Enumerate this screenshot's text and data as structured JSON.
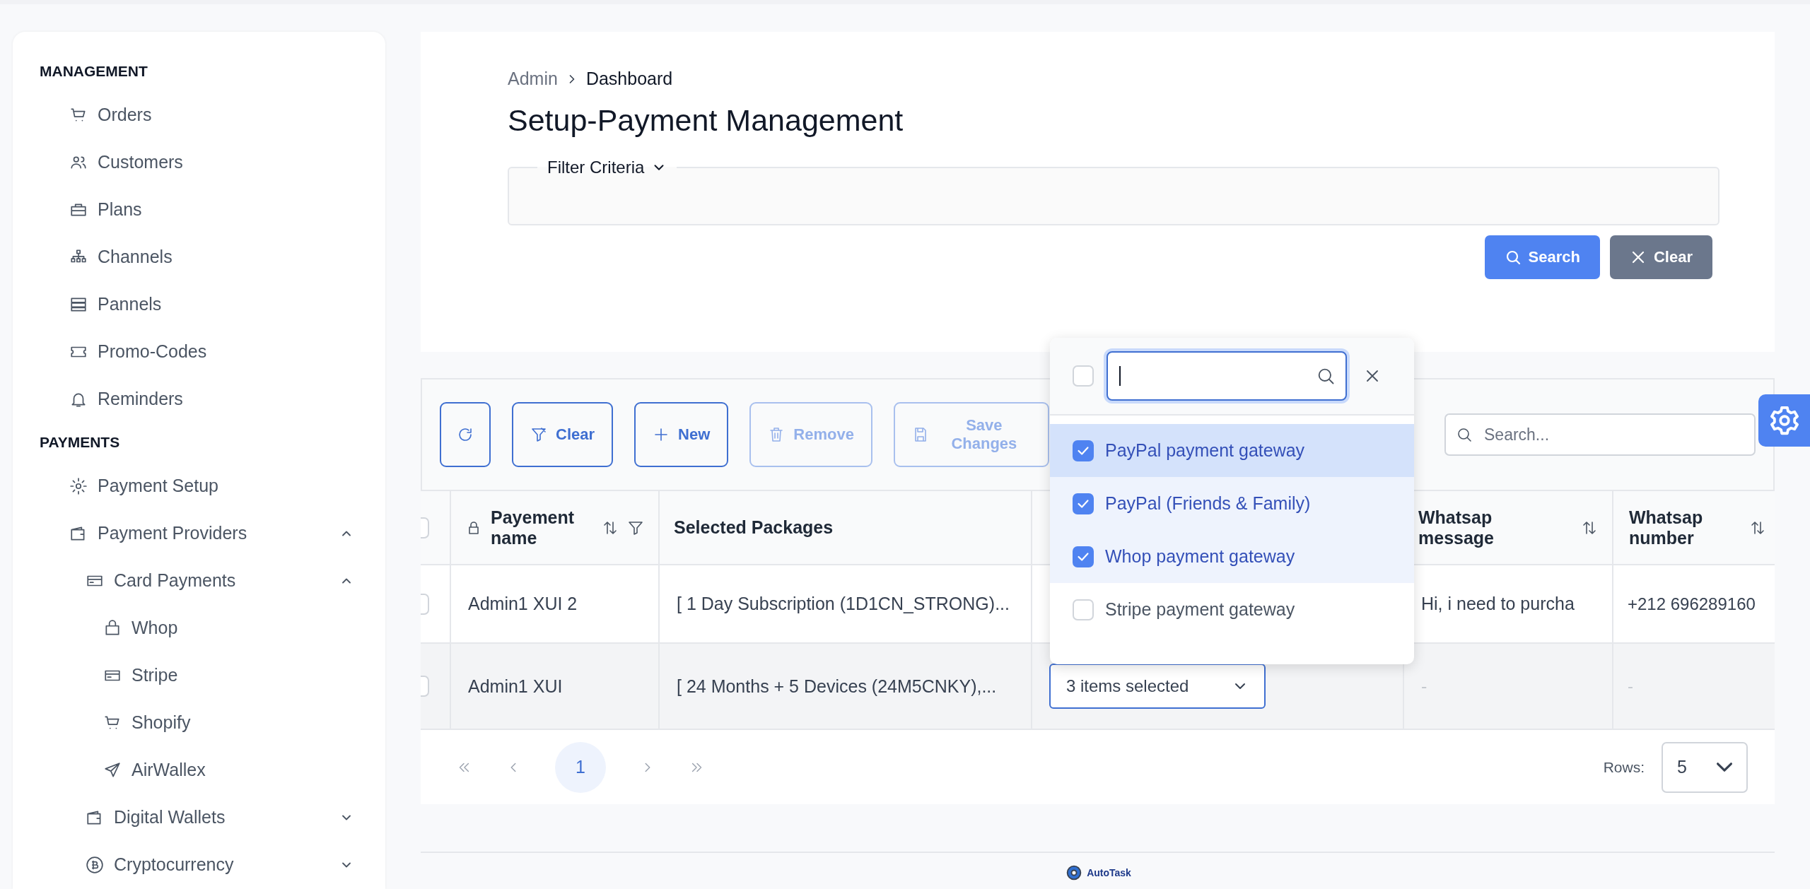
{
  "sidebar": {
    "sections": [
      {
        "title": "MANAGEMENT",
        "items": [
          {
            "label": "Orders"
          },
          {
            "label": "Customers"
          },
          {
            "label": "Plans"
          },
          {
            "label": "Channels"
          },
          {
            "label": "Pannels"
          },
          {
            "label": "Promo-Codes"
          },
          {
            "label": "Reminders"
          }
        ]
      },
      {
        "title": "PAYMENTS",
        "items": [
          {
            "label": "Payment Setup"
          },
          {
            "label": "Payment Providers",
            "expanded": true,
            "children": [
              {
                "label": "Card Payments",
                "expanded": true,
                "children": [
                  {
                    "label": "Whop"
                  },
                  {
                    "label": "Stripe"
                  },
                  {
                    "label": "Shopify"
                  },
                  {
                    "label": "AirWallex"
                  }
                ]
              },
              {
                "label": "Digital Wallets",
                "expanded": false
              },
              {
                "label": "Cryptocurrency",
                "expanded": false
              }
            ]
          }
        ]
      }
    ]
  },
  "breadcrumb": [
    "Admin",
    "Dashboard"
  ],
  "title": "Setup-Payment Management",
  "filter": {
    "legend": "Filter Criteria",
    "expanded": false
  },
  "filter_buttons": [
    {
      "kind": "search",
      "label": "Search"
    },
    {
      "kind": "clear",
      "label": "Clear"
    }
  ],
  "toolbar": {
    "buttons": [
      {
        "kind": "refresh",
        "disabled": false
      },
      {
        "kind": "clear",
        "label": "Clear",
        "disabled": false
      },
      {
        "kind": "new",
        "label": "New",
        "disabled": false
      },
      {
        "kind": "remove",
        "label": "Remove",
        "disabled": true
      },
      {
        "kind": "save",
        "label": "Save Changes",
        "disabled": true
      }
    ],
    "search": {
      "placeholder": "Search..."
    }
  },
  "table": {
    "select_all_checked": false,
    "headers": {
      "payment_name": "Payement name",
      "packages": "Selected Packages",
      "whatsapp_message": "Whatsap message",
      "whatsapp_number": "Whatsap number"
    },
    "rows": [
      {
        "checked": false,
        "active": false,
        "payment_name": "Admin1 XUI 2",
        "packages": "[ 1 Day Subscription (1D1CN_STRONG)...",
        "whatsapp_message": "Hi, i need to purcha",
        "whatsapp_number": "+212 696289160"
      },
      {
        "checked": false,
        "active": true,
        "payment_name": "Admin1 XUI",
        "packages": "[ 24 Months + 5 Devices (24M5CNKY),...",
        "gateways": "3 items selected",
        "whatsapp_message": "-",
        "whatsapp_number": "-"
      }
    ]
  },
  "dropdown": {
    "select_all_checked": false,
    "options": [
      {
        "label": "PayPal payment gateway",
        "checked": true,
        "focused": true
      },
      {
        "label": "PayPal (Friends & Family)",
        "checked": true,
        "focused": false
      },
      {
        "label": "Whop payment gateway",
        "checked": true,
        "focused": false
      },
      {
        "label": "Stripe payment gateway",
        "checked": false,
        "focused": false
      }
    ]
  },
  "pagination": {
    "pages": [
      {
        "label": "1",
        "selected": true
      }
    ],
    "rows_label": "Rows:",
    "rows_value": "5"
  },
  "footer": {
    "logo_text": "AutoTask"
  }
}
